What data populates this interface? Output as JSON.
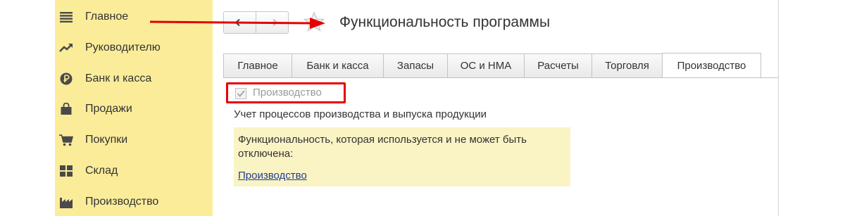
{
  "sidebar": {
    "items": [
      {
        "label": "Главное",
        "icon": "menu-lines-icon"
      },
      {
        "label": "Руководителю",
        "icon": "trend-chart-icon"
      },
      {
        "label": "Банк и касса",
        "icon": "ruble-coin-icon"
      },
      {
        "label": "Продажи",
        "icon": "shopping-bag-icon"
      },
      {
        "label": "Покупки",
        "icon": "shopping-cart-icon"
      },
      {
        "label": "Склад",
        "icon": "warehouse-grid-icon"
      },
      {
        "label": "Производство",
        "icon": "factory-icon"
      }
    ]
  },
  "header": {
    "title": "Функциональность программы"
  },
  "tabs": [
    {
      "label": "Главное"
    },
    {
      "label": "Банк и касса"
    },
    {
      "label": "Запасы"
    },
    {
      "label": "ОС и НМА"
    },
    {
      "label": "Расчеты"
    },
    {
      "label": "Торговля"
    },
    {
      "label": "Производство",
      "active": true
    }
  ],
  "content": {
    "checkbox_label": "Производство",
    "checkbox_checked": true,
    "description": "Учет процессов производства и выпуска продукции",
    "info_line1": "Функциональность, которая используется и не может быть",
    "info_line2": "отключена:",
    "info_link": "Производство"
  },
  "colors": {
    "sidebar_bg": "#fbec9a",
    "info_bg": "#faf3c4",
    "annotation": "#e60000",
    "link": "#1f3e8f"
  }
}
